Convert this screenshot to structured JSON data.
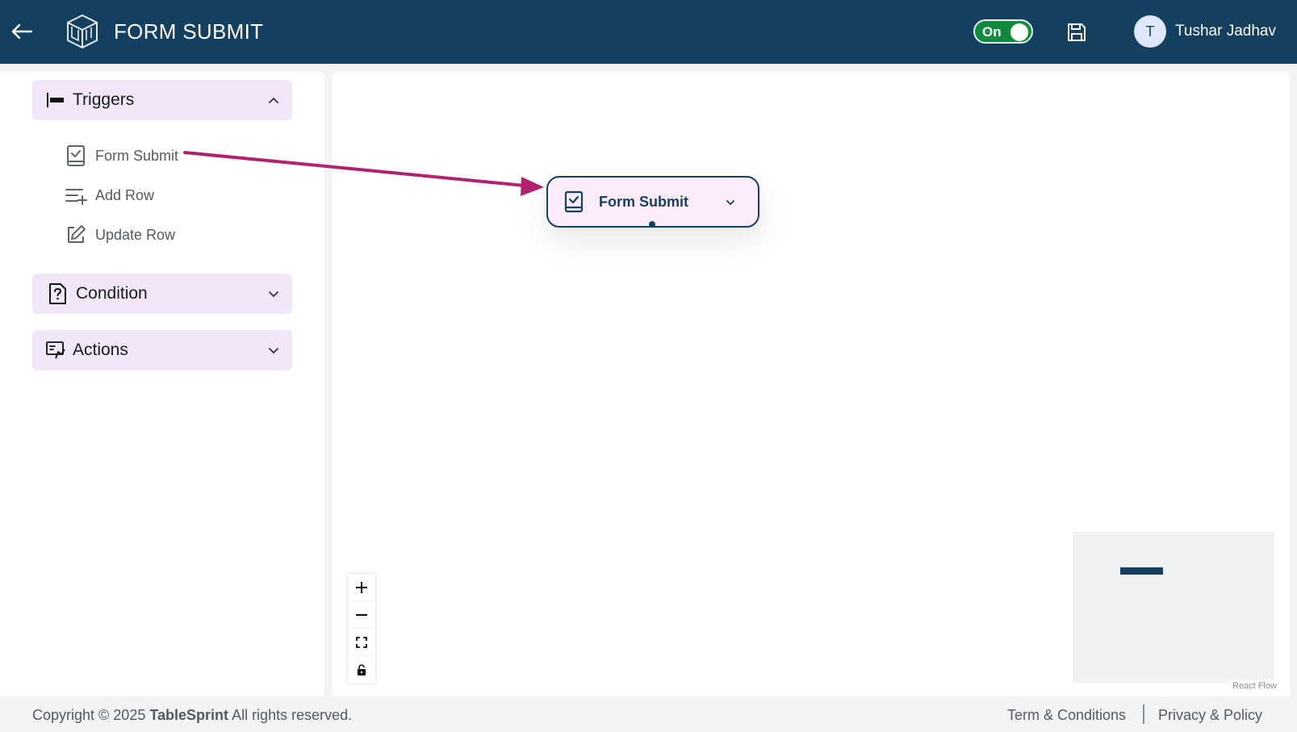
{
  "header": {
    "title": "FORM SUBMIT",
    "toggle_label": "On",
    "user_initial": "T",
    "user_name": "Tushar Jadhav"
  },
  "sidebar": {
    "sections": [
      {
        "label": "Triggers",
        "expanded": true,
        "items": [
          {
            "label": "Form Submit",
            "icon": "form-check-icon"
          },
          {
            "label": "Add Row",
            "icon": "add-row-icon"
          },
          {
            "label": "Update Row",
            "icon": "edit-icon"
          }
        ]
      },
      {
        "label": "Condition",
        "expanded": false
      },
      {
        "label": "Actions",
        "expanded": false
      }
    ]
  },
  "canvas": {
    "node": {
      "label": "Form Submit"
    },
    "attribution": "React Flow"
  },
  "footer": {
    "copyright_prefix": "Copyright © 2025",
    "brand": "TableSprint",
    "copyright_suffix": "All rights reserved.",
    "terms": "Term & Conditions",
    "privacy": "Privacy & Policy"
  },
  "colors": {
    "header_bg": "#153f5f",
    "toggle_on": "#128a3d",
    "section_bg": "#f2e6fb",
    "node_bg": "#fcebfa",
    "arrow": "#b3206e"
  }
}
